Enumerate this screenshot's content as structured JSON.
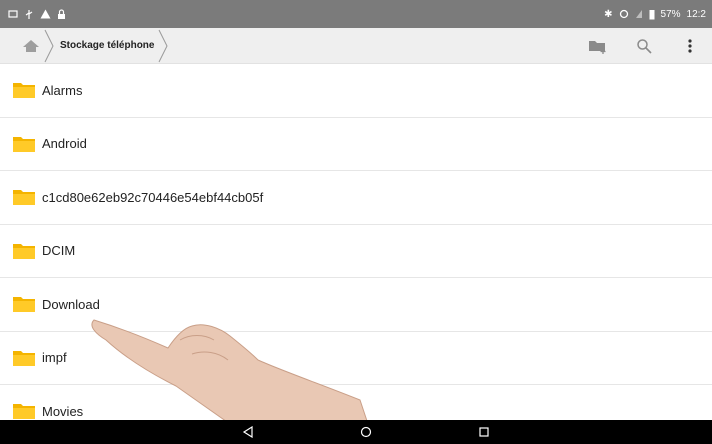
{
  "status_bar": {
    "battery_percent": "57%",
    "time": "12:2",
    "icons": [
      "screenshot-icon",
      "usb-icon",
      "warning-icon",
      "lock-icon",
      "bluetooth-icon",
      "sync-icon",
      "signal-icon",
      "battery-icon"
    ]
  },
  "toolbar": {
    "breadcrumb": "Stockage téléphone",
    "actions": [
      "new-folder-icon",
      "search-icon",
      "more-vert-icon"
    ]
  },
  "folders": [
    {
      "name": "Alarms"
    },
    {
      "name": "Android"
    },
    {
      "name": "c1cd80e62eb92c70446e54ebf44cb05f"
    },
    {
      "name": "DCIM"
    },
    {
      "name": "Download"
    },
    {
      "name": "impf"
    },
    {
      "name": "Movies"
    }
  ],
  "colors": {
    "status_bar": "#7b7b7b",
    "toolbar": "#efefef",
    "folder": "#f4b400",
    "nav_bar": "#000000"
  }
}
